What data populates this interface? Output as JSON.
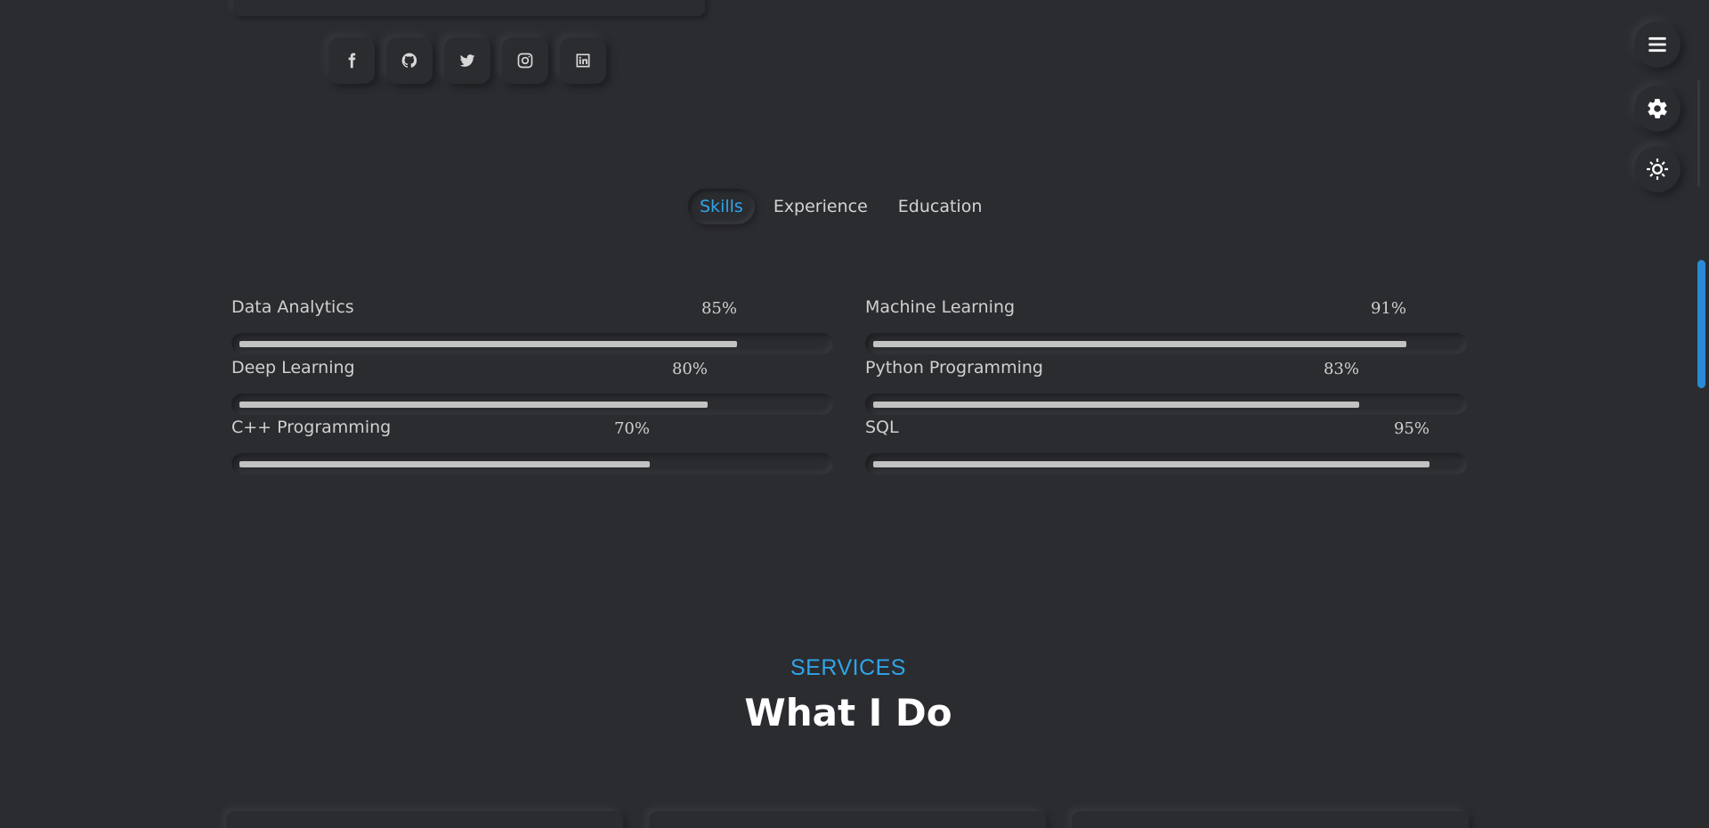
{
  "social": {
    "icons": [
      "facebook-icon",
      "github-icon",
      "twitter-icon",
      "instagram-icon",
      "linkedin-icon"
    ]
  },
  "floating": {
    "icons": [
      "menu-icon",
      "gear-icon",
      "sun-icon"
    ]
  },
  "tabs": [
    {
      "label": "Skills",
      "active": true
    },
    {
      "label": "Experience",
      "active": false
    },
    {
      "label": "Education",
      "active": false
    }
  ],
  "skills": [
    {
      "name": "Data Analytics",
      "percent_label": "85%",
      "percent": 85
    },
    {
      "name": "Machine Learning",
      "percent_label": "91%",
      "percent": 91
    },
    {
      "name": "Deep Learning",
      "percent_label": "80%",
      "percent": 80
    },
    {
      "name": "Python Programming",
      "percent_label": "83%",
      "percent": 83
    },
    {
      "name": "C++ Programming",
      "percent_label": "70%",
      "percent": 70
    },
    {
      "name": "SQL",
      "percent_label": "95%",
      "percent": 95
    }
  ],
  "services": {
    "subtitle": "SERVICES",
    "title": "What I Do"
  },
  "colors": {
    "background": "#2b2c30",
    "accent": "#2fa5e8",
    "bar_fill": "#c2c2c2"
  }
}
